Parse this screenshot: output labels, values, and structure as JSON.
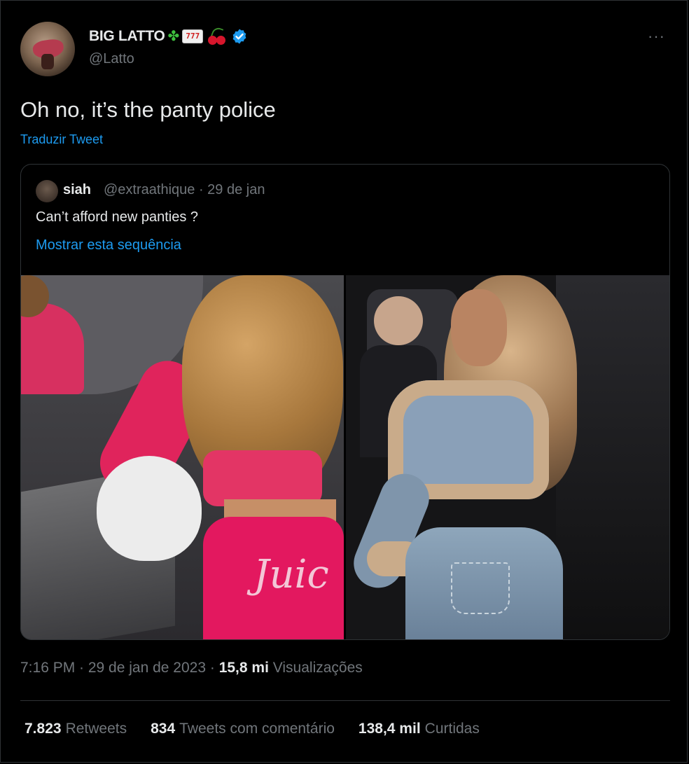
{
  "author": {
    "display_name": "BIG LATTO",
    "emojis": [
      "clover",
      "slot-machine",
      "cherries"
    ],
    "handle": "@Latto",
    "verified": true
  },
  "tweet": {
    "text": "Oh no, it’s the panty police",
    "translate_label": "Traduzir Tweet",
    "more_label": "···"
  },
  "quote": {
    "name": "siah",
    "handle_date": "@extraathique · 29 de jan",
    "text": "Can’t afford new panties ?",
    "thread_link": "Mostrar esta sequência",
    "photo_text": "Juic"
  },
  "meta": {
    "time_date": "7:16 PM · 29 de jan de 2023 · ",
    "views_count": "15,8 mi",
    "views_label": "Visualizações"
  },
  "stats": [
    {
      "count": "7.823",
      "label": "Retweets"
    },
    {
      "count": "834",
      "label": "Tweets com comentário"
    },
    {
      "count": "138,4 mil",
      "label": "Curtidas"
    }
  ],
  "colors": {
    "background": "#000000",
    "text": "#e7e9ea",
    "secondary": "#71767b",
    "link": "#1d9bf0",
    "border": "#2f3336"
  }
}
